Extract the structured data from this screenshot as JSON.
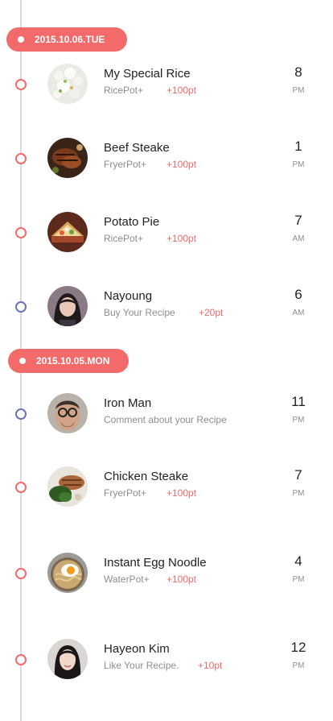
{
  "colors": {
    "accent": "#f26a6a",
    "blue_marker": "#6a72b8",
    "line": "#d9d9dc"
  },
  "sections": [
    {
      "date": "2015.10.06.TUE",
      "items": [
        {
          "title": "My Special Rice",
          "source": "RicePot+",
          "points": "+100pt",
          "hour": "8",
          "ampm": "PM",
          "icon": "rice-photo"
        },
        {
          "title": "Beef Steake",
          "source": "FryerPot+",
          "points": "+100pt",
          "hour": "1",
          "ampm": "PM",
          "icon": "steak-photo"
        },
        {
          "title": "Potato Pie",
          "source": "RicePot+",
          "points": "+100pt",
          "hour": "7",
          "ampm": "AM",
          "icon": "pie-photo"
        },
        {
          "title": "Nayoung",
          "source": "Buy Your Recipe",
          "points": "+20pt",
          "hour": "6",
          "ampm": "AM",
          "icon": "user-avatar"
        }
      ]
    },
    {
      "date": "2015.10.05.MON",
      "items": [
        {
          "title": "Iron Man",
          "source": "Comment about your Recipe",
          "points": "",
          "hour": "11",
          "ampm": "PM",
          "icon": "user-avatar"
        },
        {
          "title": "Chicken Steake",
          "source": "FryerPot+",
          "points": "+100pt",
          "hour": "7",
          "ampm": "PM",
          "icon": "chicken-photo"
        },
        {
          "title": "Instant Egg Noodle",
          "source": "WaterPot+",
          "points": "+100pt",
          "hour": "4",
          "ampm": "PM",
          "icon": "noodle-photo"
        },
        {
          "title": "Hayeon Kim",
          "source": "Like Your Recipe.",
          "points": "+10pt",
          "hour": "12",
          "ampm": "PM",
          "icon": "user-avatar"
        }
      ]
    }
  ]
}
